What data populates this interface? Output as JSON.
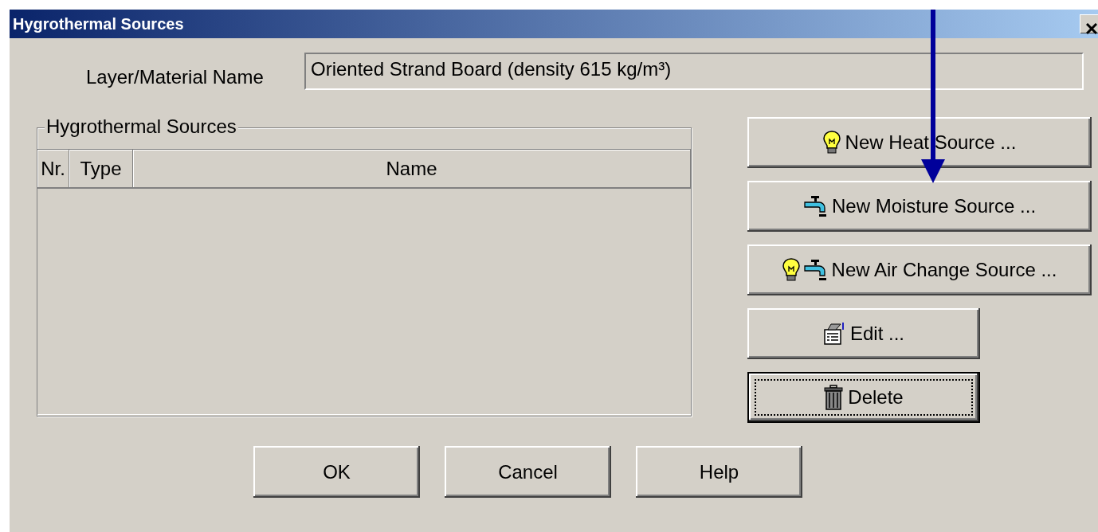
{
  "window": {
    "title": "Hygrothermal Sources"
  },
  "material": {
    "label": "Layer/Material Name",
    "value": "Oriented Strand Board (density 615 kg/m³)"
  },
  "sources": {
    "title": "Hygrothermal Sources",
    "columns": [
      "Nr.",
      "Type",
      "Name"
    ]
  },
  "actions": [
    {
      "kind": "heat",
      "label": "New Heat Source ...",
      "focused": false
    },
    {
      "kind": "moisture",
      "label": "New Moisture Source ...",
      "focused": false
    },
    {
      "kind": "air_change",
      "label": "New Air Change Source ...",
      "focused": false
    },
    {
      "kind": "edit",
      "label": "Edit ...",
      "focused": false
    },
    {
      "kind": "delete",
      "label": "Delete",
      "focused": true
    }
  ],
  "buttons": [
    "OK",
    "Cancel",
    "Help"
  ]
}
